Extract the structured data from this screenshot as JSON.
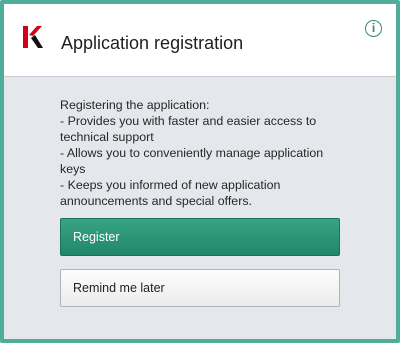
{
  "dialog": {
    "title": "Application registration",
    "info_icon": "info-circle-icon",
    "logo_icon": "kaspersky-k-logo",
    "accent_color": "#2e8b6f",
    "border_color": "#4fae99"
  },
  "content": {
    "lines": [
      "Registering the application:",
      "- Provides you with faster and easier access to technical support",
      "- Allows you to conveniently manage application keys",
      "- Keeps you informed of new application announcements and special offers."
    ]
  },
  "buttons": {
    "register_label": "Register",
    "remind_label": "Remind me later"
  }
}
